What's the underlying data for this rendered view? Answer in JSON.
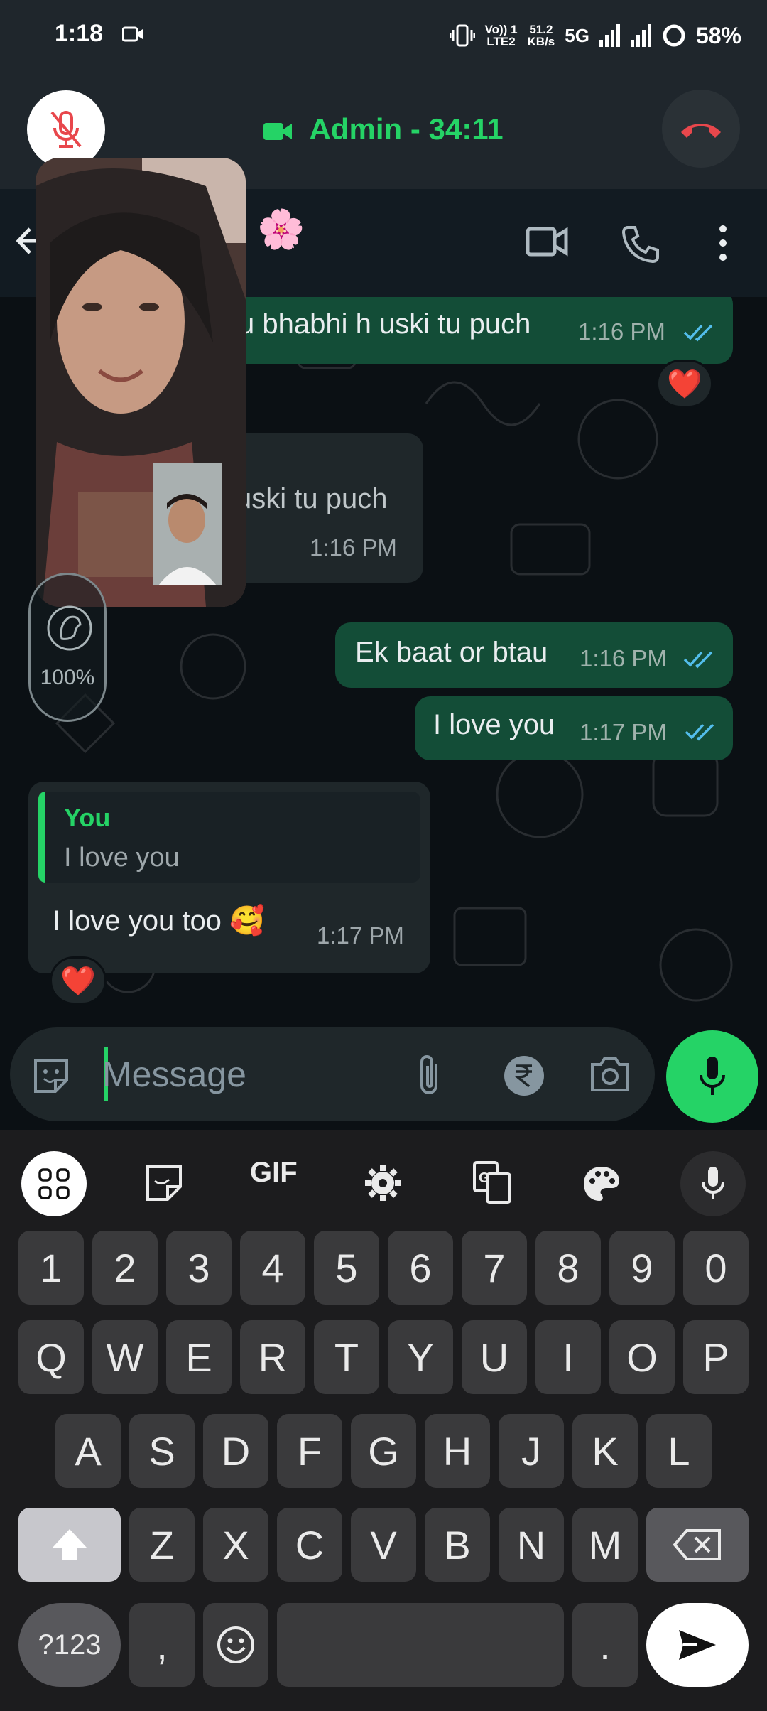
{
  "status_bar": {
    "time": "1:18",
    "network_top": "Vo)) 1",
    "network_bottom": "LTE2",
    "speed_top": "51.2",
    "speed_bottom": "KB/s",
    "network_type": "5G",
    "battery": "58%"
  },
  "call": {
    "title": "Admin - 34:11",
    "accent": "#25d366",
    "end_color": "#e8474c"
  },
  "messages": [
    {
      "direction": "out",
      "text": "u bhabhi h uski tu puch",
      "time": "1:16 PM",
      "reaction": "❤️"
    },
    {
      "direction": "in",
      "text": "uski tu puch",
      "time": "1:16 PM"
    },
    {
      "direction": "out",
      "text": "Ek baat or btau",
      "time": "1:16 PM"
    },
    {
      "direction": "out",
      "text": "I love you",
      "time": "1:17 PM"
    },
    {
      "direction": "in",
      "quote_author": "You",
      "quote_text": "I love you",
      "text": "I love you too 🥰",
      "time": "1:17 PM",
      "reaction": "❤️"
    }
  ],
  "pip": {
    "zoom_label": "100%"
  },
  "composer": {
    "placeholder": "Message"
  },
  "keyboard": {
    "toolbar": [
      "grid-icon",
      "sticker-icon",
      "GIF",
      "settings-icon",
      "translate-icon",
      "palette-icon",
      "mic-icon"
    ],
    "gif_label": "GIF",
    "row_numbers": [
      "1",
      "2",
      "3",
      "4",
      "5",
      "6",
      "7",
      "8",
      "9",
      "0"
    ],
    "row_q": [
      "Q",
      "W",
      "E",
      "R",
      "T",
      "Y",
      "U",
      "I",
      "O",
      "P"
    ],
    "row_a": [
      "A",
      "S",
      "D",
      "F",
      "G",
      "H",
      "J",
      "K",
      "L"
    ],
    "row_z": [
      "Z",
      "X",
      "C",
      "V",
      "B",
      "N",
      "M"
    ],
    "symbols_label": "?123",
    "comma_label": ",",
    "period_label": "."
  }
}
